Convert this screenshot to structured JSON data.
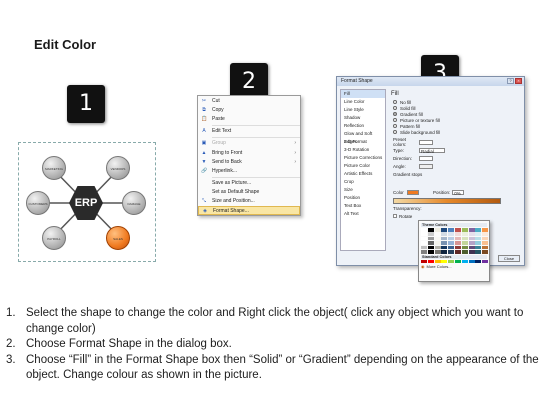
{
  "title": "Edit Color",
  "badges": [
    "1",
    "2",
    "3"
  ],
  "diagram": {
    "hub": "ERP",
    "nodes": [
      "MARKETING",
      "VENDORS",
      "CUSTOMERS",
      "DAMAGE",
      "PAYROLL",
      "SALES"
    ]
  },
  "context_menu": {
    "items": [
      {
        "icon": "✂",
        "label": "Cut"
      },
      {
        "icon": "⧉",
        "label": "Copy"
      },
      {
        "icon": "📋",
        "label": "Paste"
      },
      {
        "icon": "A",
        "label": "Edit Text"
      },
      {
        "icon": "▣",
        "label": "Group",
        "arrow": "›"
      },
      {
        "icon": "▲",
        "label": "Bring to Front",
        "arrow": "›"
      },
      {
        "icon": "▼",
        "label": "Send to Back",
        "arrow": "›"
      },
      {
        "icon": "🔗",
        "label": "Hyperlink..."
      },
      {
        "icon": "",
        "label": "Save as Picture..."
      },
      {
        "icon": "",
        "label": "Set as Default Shape"
      },
      {
        "icon": "⤡",
        "label": "Size and Position..."
      },
      {
        "icon": "◈",
        "label": "Format Shape..."
      }
    ]
  },
  "dialog": {
    "title": "Format Shape",
    "side_items": [
      "Fill",
      "Line Color",
      "Line Style",
      "Shadow",
      "Reflection",
      "Glow and Soft Edges",
      "3-D Format",
      "3-D Rotation",
      "Picture Corrections",
      "Picture Color",
      "Artistic Effects",
      "Crop",
      "Size",
      "Position",
      "Text Box",
      "Alt Text"
    ],
    "fill_heading": "Fill",
    "options": [
      "No fill",
      "Solid fill",
      "Gradient fill",
      "Picture or texture fill",
      "Pattern fill",
      "Slide background fill"
    ],
    "props": [
      "Preset colors:",
      "Type:",
      "Direction:",
      "Angle:",
      "Gradient stops"
    ],
    "type_value": "Radial",
    "color_label": "Color",
    "position_label": "Position:",
    "position_value": "0%",
    "brightness_label": "Brightness:",
    "transparency_label": "Transparency:",
    "rotate_label": "Rotate",
    "close_label": "Close"
  },
  "palette": {
    "theme_label": "Theme Colors",
    "standard_label": "Standard Colors",
    "more_label": "More Colors...",
    "theme_top": [
      "#ffffff",
      "#000000",
      "#eeece1",
      "#1f497d",
      "#4f81bd",
      "#c0504d",
      "#9bbb59",
      "#8064a2",
      "#4bacc6",
      "#f79646"
    ],
    "standard": [
      "#c00000",
      "#ff0000",
      "#ffc000",
      "#ffff00",
      "#92d050",
      "#00b050",
      "#00b0f0",
      "#0070c0",
      "#002060",
      "#7030a0"
    ]
  },
  "instructions": [
    {
      "num": "1.",
      "text": "Select the shape to change the color and Right click the object( click any object which you want to change color)"
    },
    {
      "num": "2.",
      "text": "Choose Format Shape in the dialog box."
    },
    {
      "num": "3.",
      "text": "Choose “Fill” in the Format Shape box then “Solid” or “Gradient” depending on the appearance of the object. Change colour as shown in the picture."
    }
  ]
}
